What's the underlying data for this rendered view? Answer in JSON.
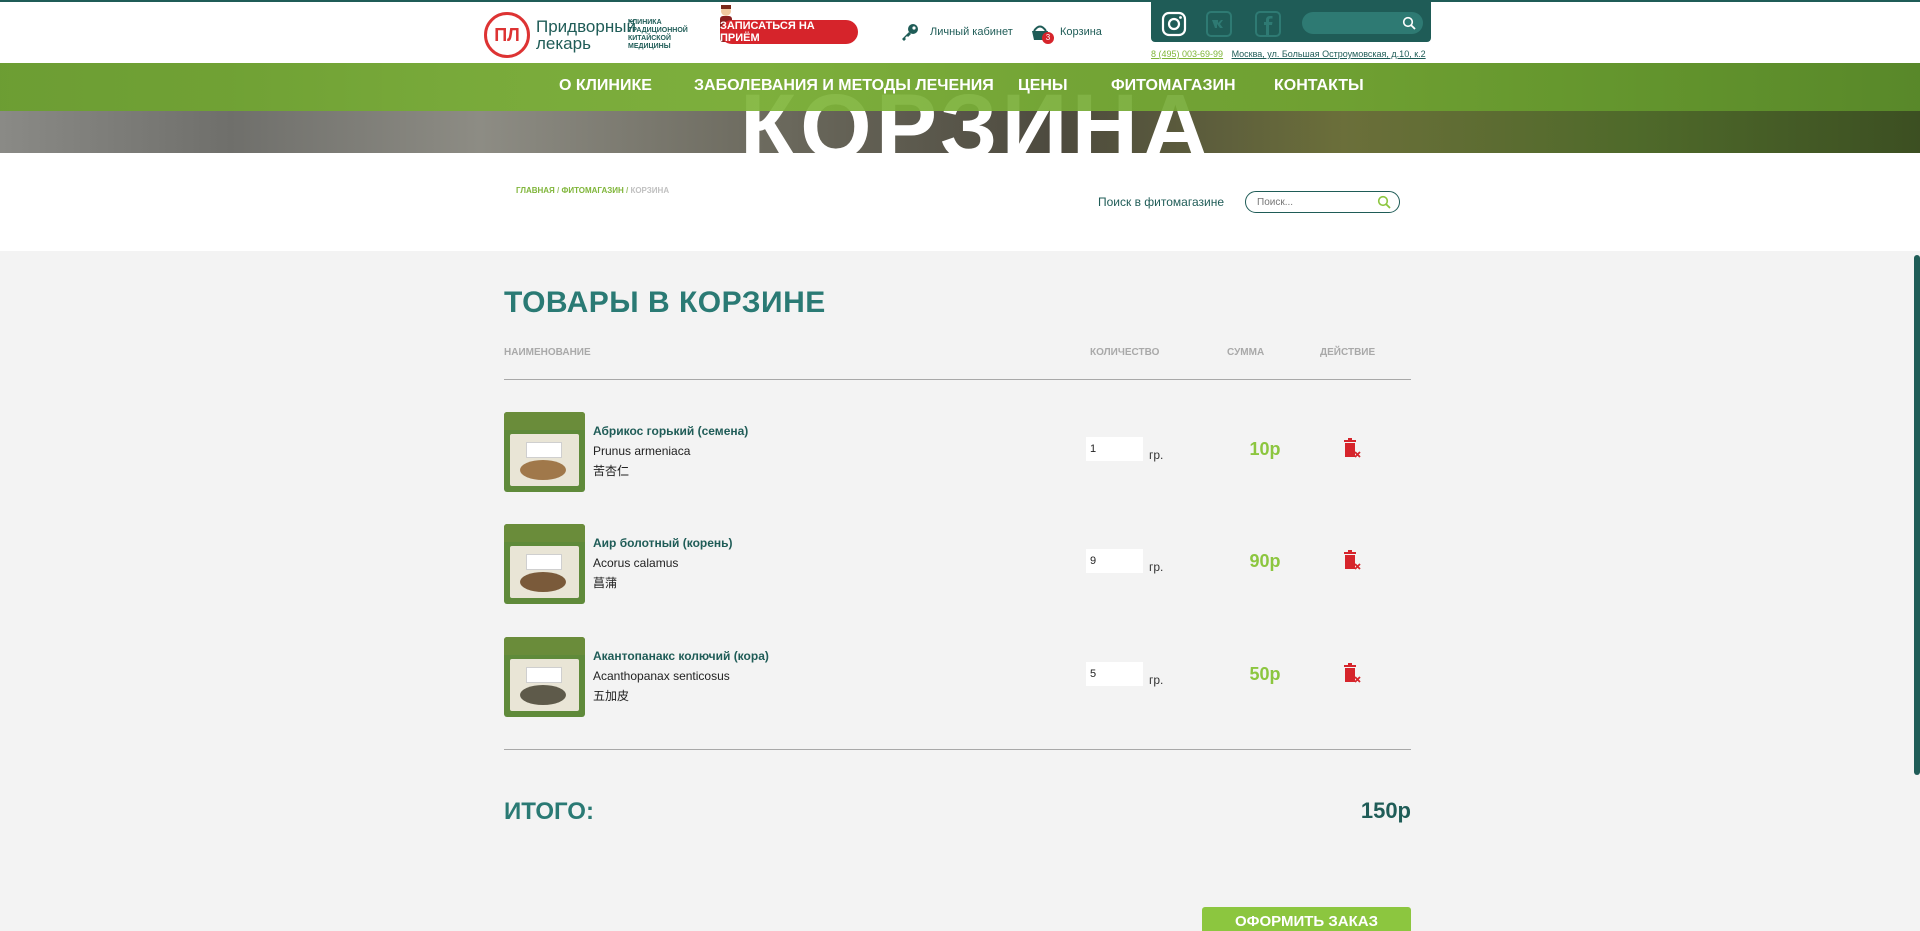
{
  "header": {
    "logo_emblem": "ПЛ",
    "logo_name": "Придворный лекарь",
    "logo_sub": "Клиника традиционной китайской медицины",
    "appointment_label": "Записаться на приём",
    "account_label": "Личный кабинет",
    "cart_label": "Корзина",
    "cart_count": "3",
    "phone": "8 (495) 003-69-99",
    "address": "Москва, ул. Большая Остроумовская, д.10, к.2"
  },
  "social": {
    "icons": [
      "instagram-icon",
      "vk-icon",
      "facebook-icon"
    ]
  },
  "nav": {
    "items": [
      "О клинике",
      "Заболевания и методы лечения",
      "Цены",
      "Фитомагазин",
      "Контакты"
    ]
  },
  "hero": {
    "title": "Корзина"
  },
  "breadcrumb": {
    "home": "Главная",
    "shop": "Фитомагазин",
    "current": "Корзина",
    "sep": " / "
  },
  "shop_search": {
    "label": "Поиск в фитомагазине",
    "placeholder": "Поиск..."
  },
  "cart": {
    "title": "Товары в корзине",
    "columns": {
      "name": "Наименование",
      "qty": "Количество",
      "sum": "Сумма",
      "action": "Действие"
    },
    "items": [
      {
        "name": "Абрикос горький (семена)",
        "latin": "Prunus armeniaca",
        "chinese": "苦杏仁",
        "qty": "1",
        "unit": "гр.",
        "sum": "10р"
      },
      {
        "name": "Аир болотный (корень)",
        "latin": "Acorus calamus",
        "chinese": "菖蒲",
        "qty": "9",
        "unit": "гр.",
        "sum": "90р"
      },
      {
        "name": "Акантопанакс колючий (кора)",
        "latin": "Acanthopanax senticosus",
        "chinese": "五加皮",
        "qty": "5",
        "unit": "гр.",
        "sum": "50р"
      }
    ],
    "total_label": "Итого:",
    "total_value": "150р",
    "checkout_label": "Оформить заказ"
  },
  "colors": {
    "brand_teal": "#1f5c57",
    "accent_green": "#8cc63f",
    "delete_red": "#d6242b"
  }
}
